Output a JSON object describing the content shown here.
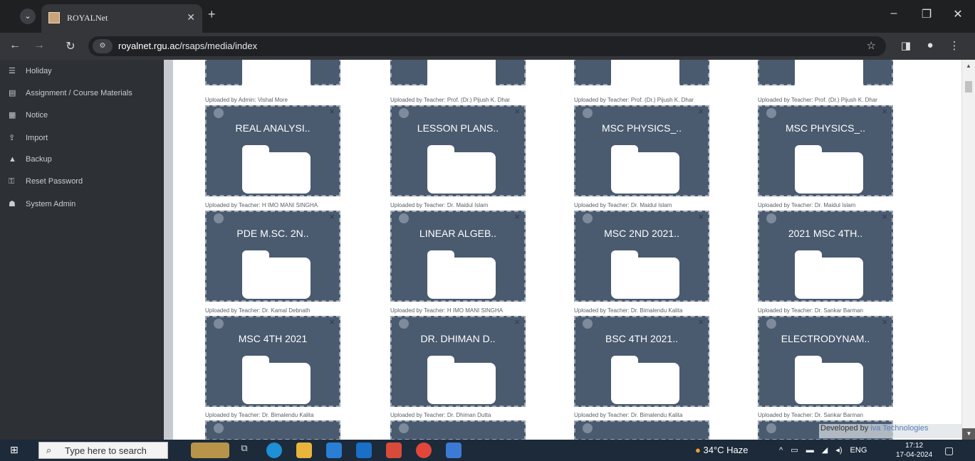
{
  "browser": {
    "tab_title": "ROYALNet",
    "url_host": "royalnet.rgu.ac",
    "url_path": "/rsaps/media/index"
  },
  "sidebar": {
    "items": [
      {
        "label": "Holiday",
        "icon": "holiday-icon"
      },
      {
        "label": "Assignment / Course Materials",
        "icon": "document-icon"
      },
      {
        "label": "Notice",
        "icon": "calendar-icon"
      },
      {
        "label": "Import",
        "icon": "upload-icon"
      },
      {
        "label": "Backup",
        "icon": "backup-icon"
      },
      {
        "label": "Reset Password",
        "icon": "key-icon"
      },
      {
        "label": "System Admin",
        "icon": "admin-icon"
      }
    ]
  },
  "media": {
    "top_uploaders": [
      "Uploaded by Admin: Vishal More",
      "Uploaded by Teacher: Prof. (Dr.) Pijush K. Dhar",
      "Uploaded by Teacher: Prof. (Dr.) Pijush K. Dhar",
      "Uploaded by Teacher: Prof. (Dr.) Pijush K. Dhar"
    ],
    "rows": [
      {
        "folders": [
          "REAL ANALYSI..",
          "LESSON PLANS..",
          "MSC PHYSICS_..",
          "MSC PHYSICS_.."
        ],
        "uploaders": [
          "Uploaded by Teacher: H IMO MANI SINGHA",
          "Uploaded by Teacher: Dr. Maidul Islam",
          "Uploaded by Teacher: Dr. Maidul Islam",
          "Uploaded by Teacher: Dr. Maidul Islam"
        ]
      },
      {
        "folders": [
          "PDE M.SC. 2N..",
          "LINEAR ALGEB..",
          "MSC 2ND 2021..",
          "2021 MSC 4TH.."
        ],
        "uploaders": [
          "Uploaded by Teacher: Dr. Kamal Debnath",
          "Uploaded by Teacher: H IMO MANI SINGHA",
          "Uploaded by Teacher: Dr. Bimalendu Kalita",
          "Uploaded by Teacher: Dr. Sankar Barman"
        ]
      },
      {
        "folders": [
          "MSC 4TH 2021",
          "DR. DHIMAN D..",
          "BSC 4TH 2021..",
          "ELECTRODYNAM.."
        ],
        "uploaders": [
          "Uploaded by Teacher: Dr. Bimalendu Kalita",
          "Uploaded by Teacher: Dr. Dhiman Dutta",
          "Uploaded by Teacher: Dr. Bimalendu Kalita",
          "Uploaded by Teacher: Dr. Sankar Barman"
        ]
      }
    ],
    "close_glyph": "×"
  },
  "footer": {
    "developed_by": "Developed by",
    "brand": "iva Technologies"
  },
  "taskbar": {
    "search_placeholder": "Type here to search",
    "weather": "34°C Haze",
    "language": "ENG",
    "time": "17:12",
    "date": "17-04-2024"
  }
}
